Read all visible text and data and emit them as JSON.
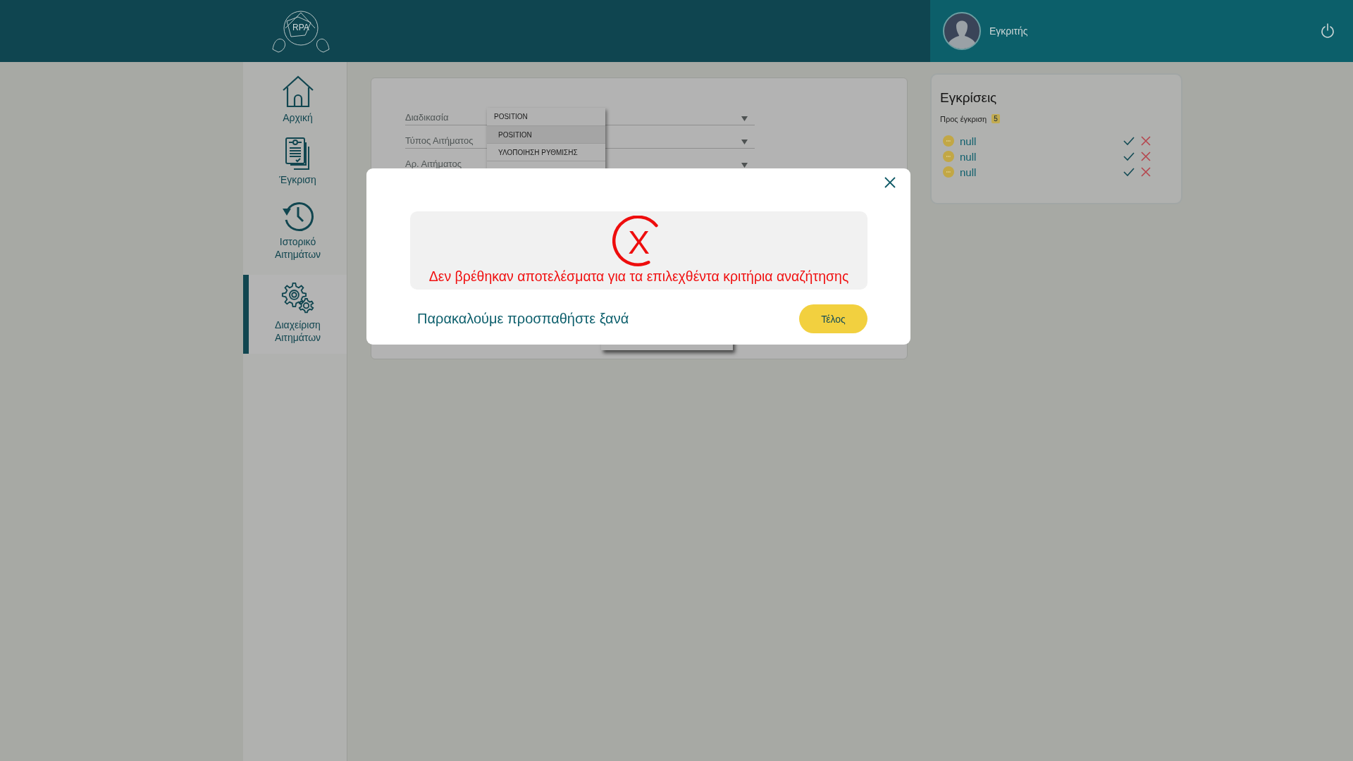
{
  "header": {
    "logo_text": "RPA",
    "user": {
      "name": "Εγκριτής"
    }
  },
  "nav": [
    {
      "label": "Αρχική",
      "kind": "home",
      "selected": false
    },
    {
      "label": "Έγκριση",
      "kind": "document",
      "selected": false
    },
    {
      "label": "Ιστορικό Αιτημάτων",
      "kind": "history",
      "selected": false
    },
    {
      "label": "Διαχείριση Αιτημάτων",
      "kind": "gears",
      "selected": true
    }
  ],
  "filters": [
    {
      "label": "Διαδικασία"
    },
    {
      "label": "Τύπος Αιτήματος"
    },
    {
      "label": "Αρ. Αιτήματος"
    }
  ],
  "dropdown": {
    "current": "POSITION",
    "options": [
      {
        "label": "POSITION",
        "selected": true
      },
      {
        "label": "ΥΛΟΠΟΙΗΣΗ ΡΥΘΜΙΣΗΣ",
        "selected": false
      }
    ]
  },
  "approvals": {
    "title": "Εγκρίσεις",
    "pending_label": "Προς έγκριση",
    "pending_count": "5",
    "items": [
      {
        "name": "null"
      },
      {
        "name": "null"
      },
      {
        "name": "null"
      }
    ]
  },
  "modal": {
    "icon_text": "X",
    "message": "Δεν βρέθηκαν αποτελέσματα για τα επιλεχθέντα κριτήρια αναζήτησης",
    "hint": "Παρακαλούμε προσπαθήστε ξανά",
    "button": "Τέλος"
  }
}
